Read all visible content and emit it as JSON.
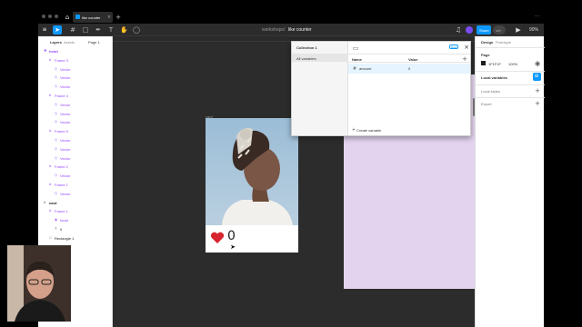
{
  "tabbar": {
    "active_tab_label": "like counter",
    "home_icon": "home-icon",
    "add_icon": "plus-icon",
    "close_icon": "close-icon"
  },
  "toolbar": {
    "breadcrumb_project": "workshops",
    "breadcrumb_sep": "/",
    "breadcrumb_file": "like counter",
    "share_label": "Share",
    "zoom_label": "90%",
    "dev_mode_label": "</>"
  },
  "left_panel": {
    "tabs": [
      "Layers",
      "Assets"
    ],
    "page_label": "Page 1",
    "layers": [
      {
        "label": "heart",
        "depth": 0,
        "kind": "component"
      },
      {
        "label": "Frame 3",
        "depth": 1,
        "kind": "frame"
      },
      {
        "label": "Vector",
        "depth": 2,
        "kind": "vector"
      },
      {
        "label": "Vector",
        "depth": 2,
        "kind": "vector"
      },
      {
        "label": "Vector",
        "depth": 2,
        "kind": "vector"
      },
      {
        "label": "Frame 4",
        "depth": 1,
        "kind": "frame"
      },
      {
        "label": "Vector",
        "depth": 2,
        "kind": "vector"
      },
      {
        "label": "Vector",
        "depth": 2,
        "kind": "vector"
      },
      {
        "label": "Vector",
        "depth": 2,
        "kind": "vector"
      },
      {
        "label": "Frame 5",
        "depth": 1,
        "kind": "frame"
      },
      {
        "label": "Vector",
        "depth": 2,
        "kind": "vector"
      },
      {
        "label": "Vector",
        "depth": 2,
        "kind": "vector"
      },
      {
        "label": "Vector",
        "depth": 2,
        "kind": "vector"
      },
      {
        "label": "Frame 2",
        "depth": 1,
        "kind": "frame"
      },
      {
        "label": "Vector",
        "depth": 2,
        "kind": "vector"
      },
      {
        "label": "Frame 1",
        "depth": 1,
        "kind": "frame"
      },
      {
        "label": "Vector",
        "depth": 2,
        "kind": "vector"
      },
      {
        "label": "card",
        "depth": 0,
        "kind": "frame-dark"
      },
      {
        "label": "Frame 1",
        "depth": 1,
        "kind": "frame"
      },
      {
        "label": "heart",
        "depth": 2,
        "kind": "instance"
      },
      {
        "label": "0",
        "depth": 2,
        "kind": "text"
      },
      {
        "label": "Rectangle 1",
        "depth": 1,
        "kind": "rect"
      }
    ]
  },
  "canvas": {
    "card_frame_label": "card",
    "like_count": "0"
  },
  "variables_modal": {
    "collection_label": "Collection 1",
    "all_variables_label": "All variables",
    "beta_badge": "Beta",
    "columns": [
      "Name",
      "Value"
    ],
    "rows": [
      {
        "name": "amount",
        "value": "0"
      }
    ],
    "create_label": "Create variable"
  },
  "right_panel": {
    "tabs": [
      "Design",
      "Prototype"
    ],
    "page_section": "Page",
    "page_color_hex": "1F1F1F",
    "page_opacity": "100%",
    "local_variables": "Local variables",
    "local_styles": "Local styles",
    "export": "Export"
  },
  "colors": {
    "accent": "#0d99ff",
    "component": "#9747ff",
    "canvas": "#2c2c2c",
    "lilac_frame": "#e3d3ef",
    "heart_red": "#d6252f"
  }
}
